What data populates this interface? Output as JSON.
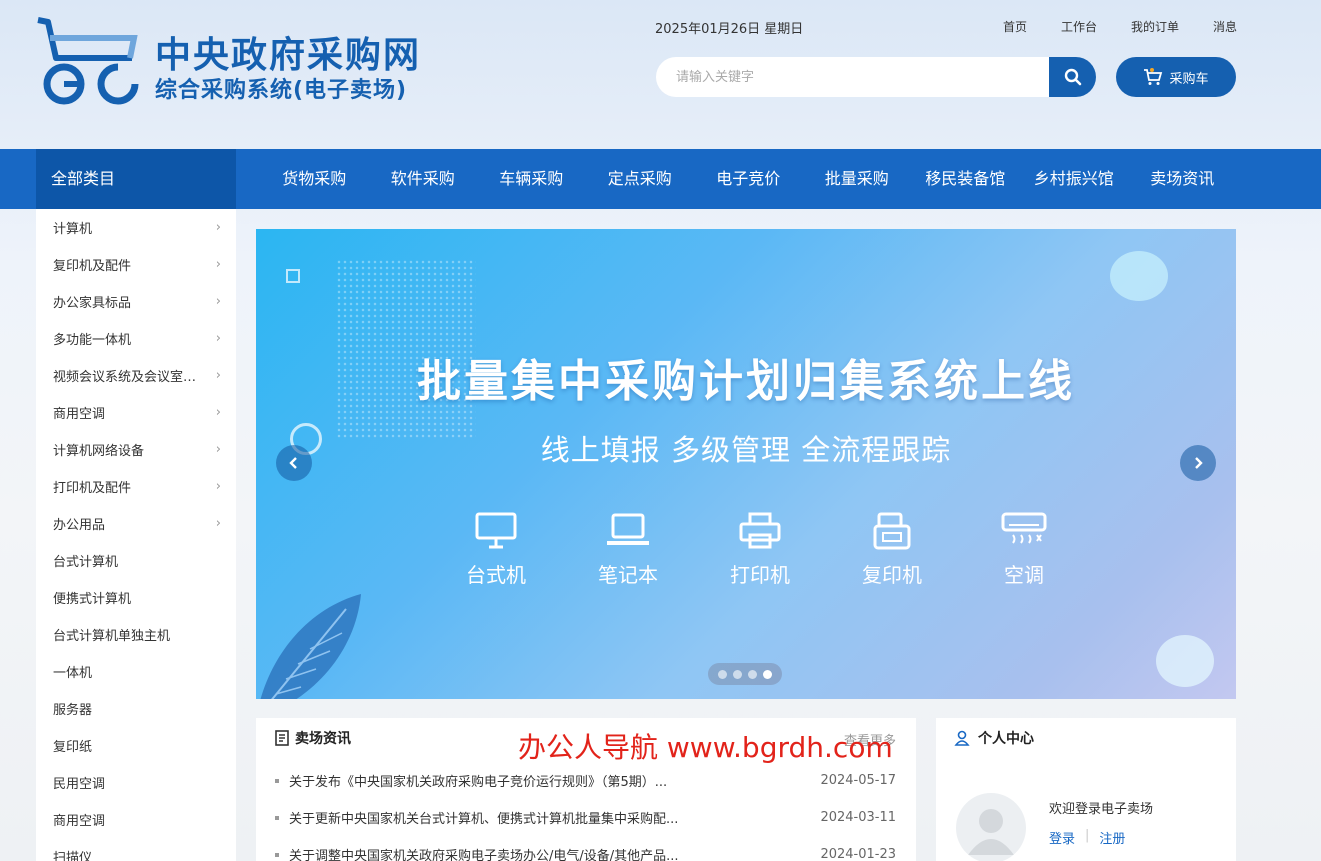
{
  "brand": {
    "logo_text": "GC",
    "title": "中央政府采购网",
    "subtitle": "综合采购系统(电子卖场)"
  },
  "header": {
    "date": "2025年01月26日 星期日",
    "links": [
      "首页",
      "工作台",
      "我的订单",
      "消息"
    ],
    "search_placeholder": "请输入关键字",
    "cart_label": "采购车"
  },
  "nav": {
    "all_categories": "全部类目",
    "items": [
      "货物采购",
      "软件采购",
      "车辆采购",
      "定点采购",
      "电子竞价",
      "批量采购",
      "移民装备馆",
      "乡村振兴馆",
      "卖场资讯"
    ]
  },
  "sidebar": {
    "items": [
      {
        "label": "计算机",
        "has_children": true
      },
      {
        "label": "复印机及配件",
        "has_children": true
      },
      {
        "label": "办公家具标品",
        "has_children": true
      },
      {
        "label": "多功能一体机",
        "has_children": true
      },
      {
        "label": "视频会议系统及会议室音…",
        "has_children": true
      },
      {
        "label": "商用空调",
        "has_children": true
      },
      {
        "label": "计算机网络设备",
        "has_children": true
      },
      {
        "label": "打印机及配件",
        "has_children": true
      },
      {
        "label": "办公用品",
        "has_children": true
      },
      {
        "label": "台式计算机",
        "has_children": false
      },
      {
        "label": "便携式计算机",
        "has_children": false
      },
      {
        "label": "台式计算机单独主机",
        "has_children": false
      },
      {
        "label": "一体机",
        "has_children": false
      },
      {
        "label": "服务器",
        "has_children": false
      },
      {
        "label": "复印纸",
        "has_children": false
      },
      {
        "label": "民用空调",
        "has_children": false
      },
      {
        "label": "商用空调",
        "has_children": false
      },
      {
        "label": "扫描仪",
        "has_children": false
      }
    ]
  },
  "banner": {
    "title": "批量集中采购计划归集系统上线",
    "subtitle": "线上填报 多级管理 全流程跟踪",
    "icons": [
      {
        "label": "台式机",
        "icon": "desktop-icon"
      },
      {
        "label": "笔记本",
        "icon": "laptop-icon"
      },
      {
        "label": "打印机",
        "icon": "printer-icon"
      },
      {
        "label": "复印机",
        "icon": "copier-icon"
      },
      {
        "label": "空调",
        "icon": "air-conditioner-icon"
      }
    ],
    "slide_count": 4,
    "active_slide": 4
  },
  "news": {
    "title": "卖场资讯",
    "more": "查看更多",
    "items": [
      {
        "title": "关于发布《中央国家机关政府采购电子竞价运行规则》（第5期）...",
        "date": "2024-05-17"
      },
      {
        "title": "关于更新中央国家机关台式计算机、便携式计算机批量集中采购配...",
        "date": "2024-03-11"
      },
      {
        "title": "关于调整中央国家机关政府采购电子卖场办公/电气/设备/其他产品...",
        "date": "2024-01-23"
      }
    ]
  },
  "personal": {
    "title": "个人中心",
    "welcome": "欢迎登录电子卖场",
    "login": "登录",
    "register": "注册"
  },
  "watermark": "办公人导航 www.bgrdh.com",
  "colors": {
    "brand_blue": "#1560b0",
    "nav_blue": "#1868c4",
    "nav_all_blue": "#0d56a8",
    "watermark_red": "#e2231a"
  }
}
